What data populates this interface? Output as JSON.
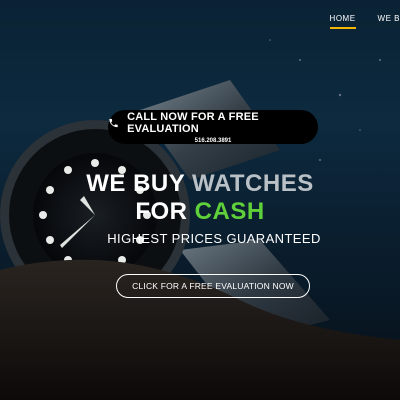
{
  "nav": {
    "items": [
      {
        "label": "HOME",
        "active": true
      },
      {
        "label": "WE B"
      }
    ],
    "active_color": "#f2b705"
  },
  "call_button": {
    "label": "CALL NOW FOR A FREE EVALUATION",
    "phone": "516.208.3891",
    "icon": "phone-icon"
  },
  "headline": {
    "line1_a": "WE BUY",
    "line1_b": "WATCHES",
    "line2_a": "FOR",
    "line2_b": "CASH",
    "accent_color": "#5fcf3a"
  },
  "subheadline": "HIGHEST PRICES GUARANTEED",
  "cta": {
    "label": "CLICK FOR A FREE EVALUATION NOW"
  }
}
